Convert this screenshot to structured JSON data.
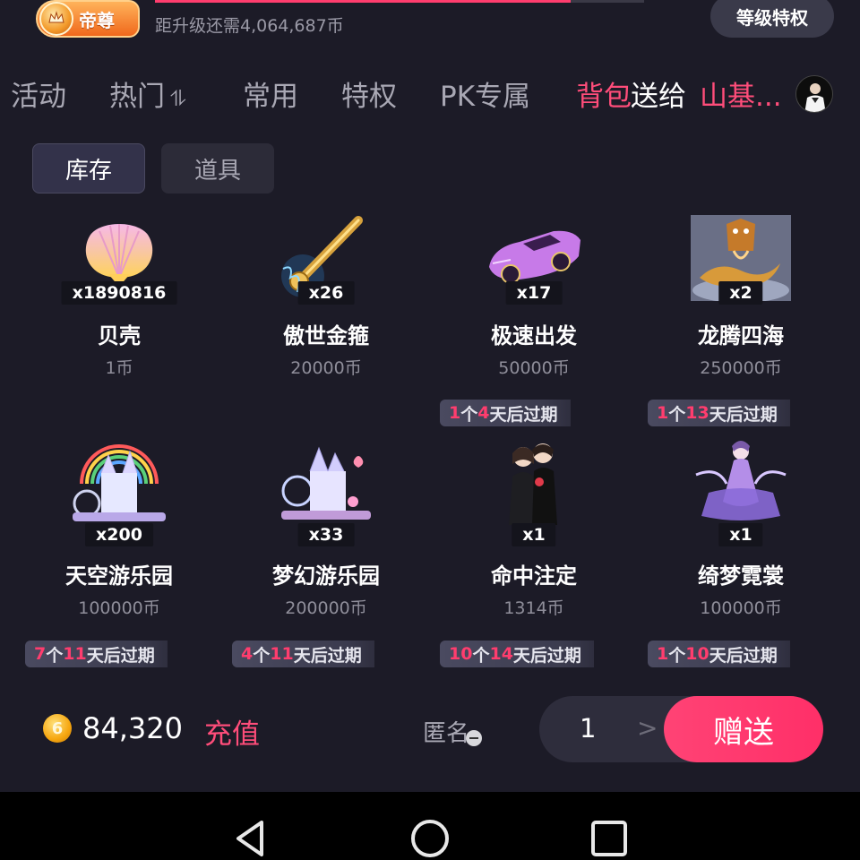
{
  "header": {
    "level_name": "帝尊",
    "upgrade_text": "距升级还需4,064,687币",
    "progress_fraction": 0.85,
    "privilege_label": "等级特权",
    "accent": "#ff3d6e"
  },
  "tabs": [
    {
      "label": "活动"
    },
    {
      "label": "热门",
      "icon": "sort-arrows-icon",
      "icon_glyph": "⥮"
    },
    {
      "label": "常用"
    },
    {
      "label": "特权"
    },
    {
      "label": "PK专属"
    },
    {
      "label": "背包",
      "active": true
    }
  ],
  "send_to": {
    "label": "送给",
    "recipient": "山基..."
  },
  "subtabs": [
    {
      "label": "库存",
      "selected": true
    },
    {
      "label": "道具",
      "selected": false
    }
  ],
  "gifts": [
    {
      "name": "贝壳",
      "count": "x1890816",
      "price": "1币",
      "icon": "shell-icon"
    },
    {
      "name": "傲世金箍",
      "count": "x26",
      "price": "20000币",
      "icon": "golden-staff-icon"
    },
    {
      "name": "极速出发",
      "count": "x17",
      "price": "50000币",
      "icon": "sports-car-icon"
    },
    {
      "name": "龙腾四海",
      "count": "x2",
      "price": "250000币",
      "icon": "dragon-icon"
    },
    {
      "name": "天空游乐园",
      "count": "x200",
      "price": "100000币",
      "icon": "sky-castle-icon"
    },
    {
      "name": "梦幻游乐园",
      "count": "x33",
      "price": "200000币",
      "icon": "dream-castle-icon"
    },
    {
      "name": "命中注定",
      "count": "x1",
      "price": "1314币",
      "icon": "couple-icon"
    },
    {
      "name": "绮梦霓裳",
      "count": "x1",
      "price": "100000币",
      "icon": "fairy-dress-icon"
    }
  ],
  "expiry_tags": [
    {
      "qty": "1",
      "mid": "个",
      "days": "4",
      "suffix": "天后过期"
    },
    {
      "qty": "1",
      "mid": "个",
      "days": "13",
      "suffix": "天后过期"
    },
    {
      "qty": "7",
      "mid": "个",
      "days": "11",
      "suffix": "天后过期"
    },
    {
      "qty": "4",
      "mid": "个",
      "days": "11",
      "suffix": "天后过期"
    },
    {
      "qty": "10",
      "mid": "个",
      "days": "14",
      "suffix": "天后过期"
    },
    {
      "qty": "1",
      "mid": "个",
      "days": "10",
      "suffix": "天后过期"
    }
  ],
  "footer": {
    "coin_glyph": "6",
    "balance": "84,320",
    "recharge_label": "充值",
    "anonymous_label": "匿名",
    "quantity": "1",
    "next_glyph": ">",
    "send_label": "赠送"
  },
  "navbar": {
    "back_icon": "back-triangle-icon",
    "home_icon": "home-circle-icon",
    "recents_icon": "recents-square-icon"
  }
}
